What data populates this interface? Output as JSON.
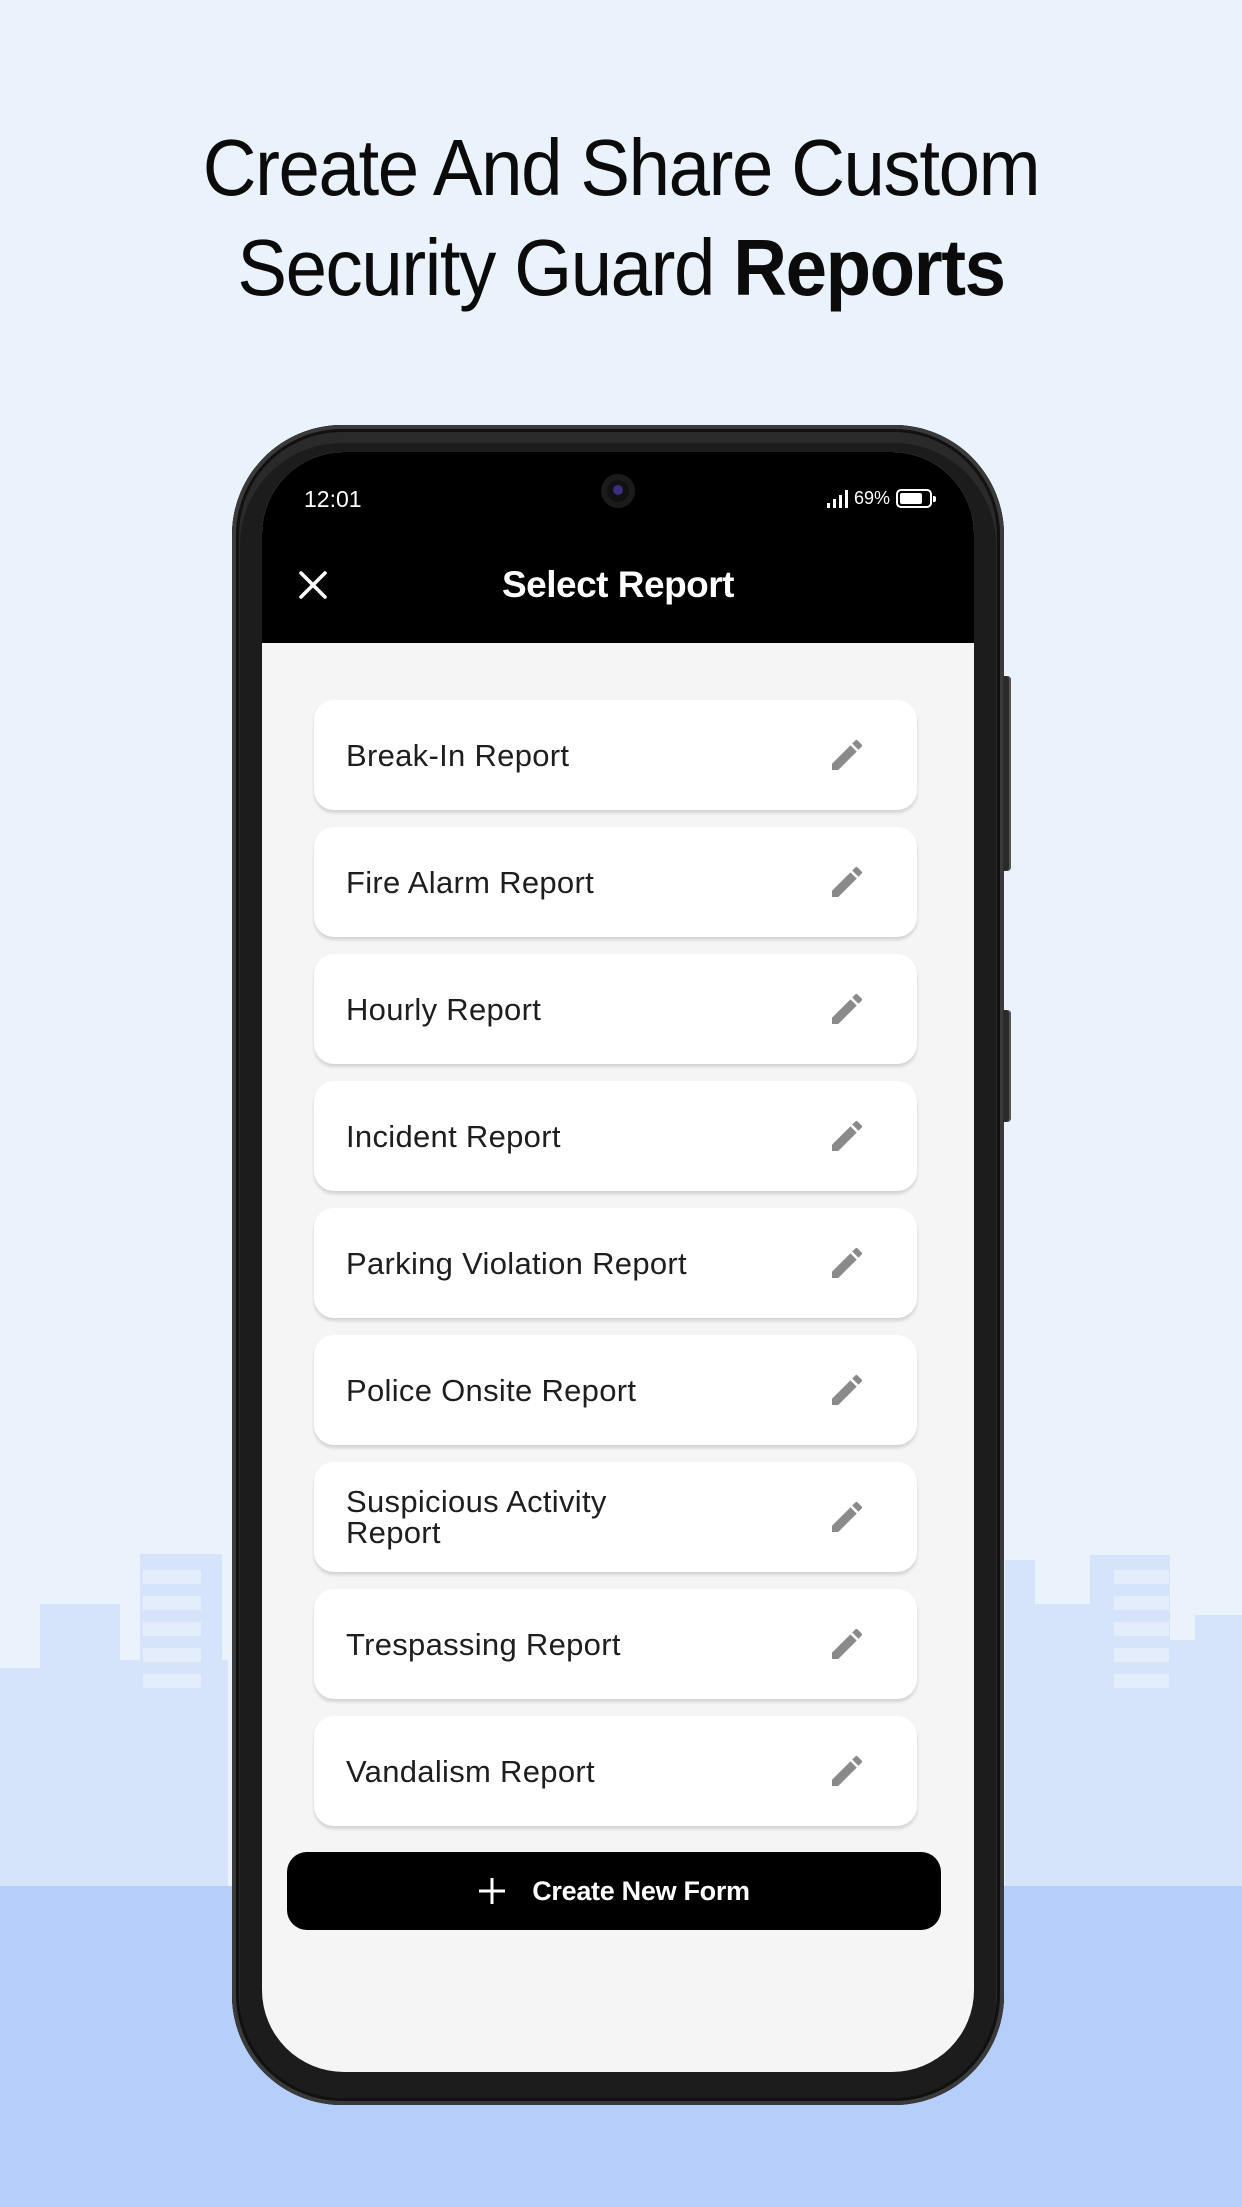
{
  "headline": {
    "line1": "Create And Share Custom",
    "line2_regular": "Security Guard ",
    "line2_bold": "Reports"
  },
  "status_bar": {
    "time": "12:01",
    "battery_percent": "69%",
    "signal_icon": "signal-icon",
    "battery_icon": "battery-icon"
  },
  "app_bar": {
    "title": "Select Report",
    "close_icon": "close-icon"
  },
  "reports": [
    {
      "label": "Break-In Report",
      "icon": "pencil-icon"
    },
    {
      "label": "Fire Alarm Report",
      "icon": "pencil-icon"
    },
    {
      "label": "Hourly Report",
      "icon": "pencil-icon"
    },
    {
      "label": "Incident Report",
      "icon": "pencil-icon"
    },
    {
      "label": "Parking Violation Report",
      "icon": "pencil-icon"
    },
    {
      "label": "Police Onsite Report",
      "icon": "pencil-icon"
    },
    {
      "label": "Suspicious Activity Report",
      "icon": "pencil-icon"
    },
    {
      "label": "Trespassing Report",
      "icon": "pencil-icon"
    },
    {
      "label": "Vandalism Report",
      "icon": "pencil-icon"
    }
  ],
  "create_button": {
    "label": "Create New Form",
    "icon": "plus-icon"
  },
  "colors": {
    "background": "#eaf2fc",
    "ground": "#b5cefa",
    "app_bar": "#000000",
    "screen_bg": "#f5f5f5",
    "card_bg": "#ffffff",
    "icon_gray": "#8a8a8a"
  }
}
